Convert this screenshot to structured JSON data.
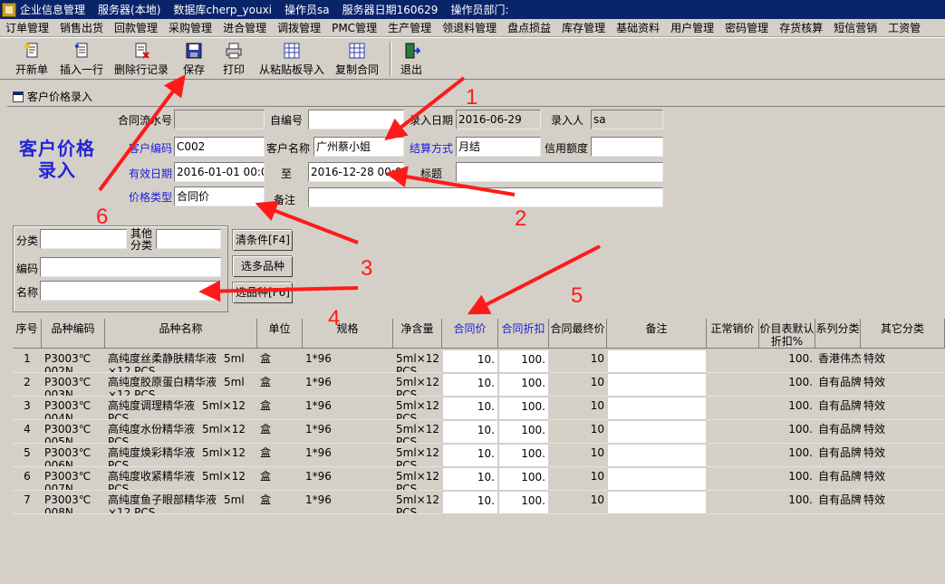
{
  "titlebar": {
    "app": "企业信息管理",
    "server": "服务器(本地)",
    "db": "数据库cherp_youxi",
    "operator": "操作员sa",
    "server_date": "服务器日期160629",
    "dept": "操作员部门:"
  },
  "menu": [
    "订单管理",
    "销售出货",
    "回款管理",
    "采购管理",
    "进合管理",
    "调拨管理",
    "PMC管理",
    "生产管理",
    "领退料管理",
    "盘点损益",
    "库存管理",
    "基础资料",
    "用户管理",
    "密码管理",
    "存货核算",
    "短信营销",
    "工资管"
  ],
  "toolbar": {
    "new": "开新单",
    "insert_row": "插入一行",
    "delete_row": "删除行记录",
    "save": "保存",
    "print": "打印",
    "paste_import": "从粘贴板导入",
    "copy_contract": "复制合同",
    "exit": "退出"
  },
  "window_title": "客户价格录入",
  "big_title": [
    "客户价格",
    "录入"
  ],
  "form": {
    "contract_no_label": "合同流水号",
    "contract_no": "",
    "self_no_label": "自编号",
    "self_no": "",
    "entry_date_label": "录入日期",
    "entry_date": "2016-06-29",
    "entry_person_label": "录入人",
    "entry_person": "sa",
    "cust_code_label": "客户编码",
    "cust_code": "C002",
    "cust_name_label": "客户名称",
    "cust_name": "广州蔡小姐",
    "settle_label": "结算方式",
    "settle": "月结",
    "credit_label": "信用额度",
    "credit": "",
    "valid_label": "有效日期",
    "valid_from": "2016-01-01 00:00",
    "to_label": "至",
    "valid_to": "2016-12-28 00:00",
    "subject_label": "标题",
    "subject": "",
    "price_type_label": "价格类型",
    "price_type": "合同价",
    "remark_label": "备注",
    "remark": ""
  },
  "filter": {
    "category_label": "分类",
    "category": "",
    "other_label_1": "其他",
    "other_label_2": "分类",
    "other": "",
    "code_label": "编码",
    "code": "",
    "name_label": "名称",
    "name": "",
    "clear_btn": "清条件[F4]",
    "multi_btn": "选多品种",
    "select_btn": "选品种[F6]"
  },
  "grid": {
    "headers": {
      "seq": "序号",
      "code": "品种编码",
      "name": "品种名称",
      "unit": "单位",
      "spec": "规格",
      "net": "净含量",
      "contract_price": "合同价",
      "contract_discount": "合同折扣",
      "final_price": "合同最终价",
      "remark": "备注",
      "normal_price": "正常销价",
      "default_discount_1": "价目表默认",
      "default_discount_2": "折扣%",
      "series": "系列分类",
      "other": "其它分类"
    },
    "rows": [
      {
        "seq": "1",
        "code1": "P3003℃",
        "code2": "002N",
        "name1": "高纯度丝柔静肤精华液",
        "unitsize": "5ml",
        "name2": "×12 PCS",
        "unit": "盒",
        "spec": "1*96",
        "net1": "5ml×12",
        "net2": "PCS",
        "price": "10.",
        "discount": "100.",
        "final": "10",
        "remark": "",
        "normal": "",
        "defdisc": "100.",
        "series": "香港伟杰",
        "other": "特效"
      },
      {
        "seq": "2",
        "code1": "P3003℃",
        "code2": "003N",
        "name1": "高纯度胶原蛋白精华液",
        "unitsize": "5ml",
        "name2": "×12 PCS",
        "unit": "盒",
        "spec": "1*96",
        "net1": "5ml×12",
        "net2": "PCS",
        "price": "10.",
        "discount": "100.",
        "final": "10",
        "remark": "",
        "normal": "",
        "defdisc": "100.",
        "series": "自有品牌",
        "other": "特效"
      },
      {
        "seq": "3",
        "code1": "P3003℃",
        "code2": "004N",
        "name1": "高纯度调理精华液",
        "unitsize": "5ml×12",
        "name2": "PCS",
        "unit": "盒",
        "spec": "1*96",
        "net1": "5ml×12",
        "net2": "PCS",
        "price": "10.",
        "discount": "100.",
        "final": "10",
        "remark": "",
        "normal": "",
        "defdisc": "100.",
        "series": "自有品牌",
        "other": "特效"
      },
      {
        "seq": "4",
        "code1": "P3003℃",
        "code2": "005N",
        "name1": "高纯度水份精华液",
        "unitsize": "5ml×12",
        "name2": "PCS",
        "unit": "盒",
        "spec": "1*96",
        "net1": "5ml×12",
        "net2": "PCS",
        "price": "10.",
        "discount": "100.",
        "final": "10",
        "remark": "",
        "normal": "",
        "defdisc": "100.",
        "series": "自有品牌",
        "other": "特效"
      },
      {
        "seq": "5",
        "code1": "P3003℃",
        "code2": "006N",
        "name1": "高纯度焕彩精华液",
        "unitsize": "5ml×12",
        "name2": "PCS",
        "unit": "盒",
        "spec": "1*96",
        "net1": "5ml×12",
        "net2": "PCS",
        "price": "10.",
        "discount": "100.",
        "final": "10",
        "remark": "",
        "normal": "",
        "defdisc": "100.",
        "series": "自有品牌",
        "other": "特效"
      },
      {
        "seq": "6",
        "code1": "P3003℃",
        "code2": "007N",
        "name1": "高纯度收紧精华液",
        "unitsize": "5ml×12",
        "name2": "PCS",
        "unit": "盒",
        "spec": "1*96",
        "net1": "5ml×12",
        "net2": "PCS",
        "price": "10.",
        "discount": "100.",
        "final": "10",
        "remark": "",
        "normal": "",
        "defdisc": "100.",
        "series": "自有品牌",
        "other": "特效"
      },
      {
        "seq": "7",
        "code1": "P3003℃",
        "code2": "008N",
        "name1": "高纯度鱼子眼部精华液",
        "unitsize": "5ml",
        "name2": "×12 PCS",
        "unit": "盒",
        "spec": "1*96",
        "net1": "5ml×12",
        "net2": "PCS",
        "price": "10.",
        "discount": "100.",
        "final": "10",
        "remark": "",
        "normal": "",
        "defdisc": "100.",
        "series": "自有品牌",
        "other": "特效"
      }
    ]
  },
  "annotations": [
    "1",
    "2",
    "3",
    "4",
    "5",
    "6"
  ],
  "colors": {
    "title_bg": "#0a246a",
    "label_blue": "#1c1cdc",
    "arrow_red": "#ff1a1a"
  }
}
